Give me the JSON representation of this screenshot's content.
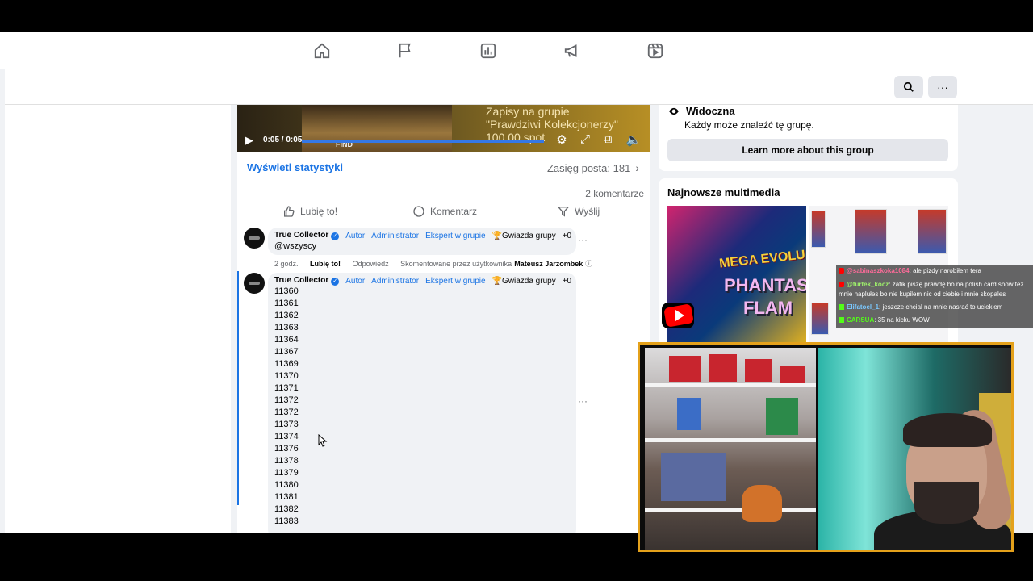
{
  "nav": {
    "icons": [
      "home-icon",
      "flag-icon",
      "stats-icon",
      "megaphone-icon",
      "reels-icon"
    ]
  },
  "subbar": {
    "search_icon": "search-icon",
    "more_label": "···"
  },
  "video": {
    "overlay_text_line1": "Zapisy na grupie",
    "overlay_text_line2": "\"Prawdziwi Kolekcjonerzy\"",
    "overlay_text_line3": "100,00 spot",
    "find_label": "FIND",
    "time": "0:05 / 0:05",
    "progress_fraction": 1.0
  },
  "post": {
    "stats_link": "Wyświetl statystyki",
    "reach": "Zasięg posta: 181",
    "comments_count": "2 komentarze",
    "actions": {
      "like": "Lubię to!",
      "comment": "Komentarz",
      "send": "Wyślij"
    }
  },
  "comments": [
    {
      "author": "True Collector",
      "badges": [
        "Autor",
        "Administrator",
        "Ekspert w grupie"
      ],
      "star_badge": "Gwiazda grupy",
      "plus": "+0",
      "text": "@wszyscy",
      "meta": {
        "time": "2 godz.",
        "like": "Lubię to!",
        "reply": "Odpowiedz",
        "commented_by": "Skomentowane przez użytkownika",
        "commenter": "Mateusz Jarzombek"
      }
    },
    {
      "author": "True Collector",
      "badges": [
        "Autor",
        "Administrator",
        "Ekspert w grupie"
      ],
      "star_badge": "Gwiazda grupy",
      "plus": "+0",
      "lines": [
        "11360",
        "11361",
        "11362",
        "11363",
        "11364",
        "11367",
        "11369",
        "11370",
        "11371",
        "11372",
        "11372",
        "11373",
        "11374",
        "11376",
        "11378",
        "11379",
        "11380",
        "11381",
        "11382",
        "11383"
      ]
    }
  ],
  "sidebar": {
    "visibility_title": "Widoczna",
    "visibility_desc": "Każdy może znaleźć tę grupę.",
    "learn_more": "Learn more about this group",
    "media_title": "Najnowsze multimedia",
    "media_text_1": "MEGA EVOLU",
    "media_text_2": "PHANTAS",
    "media_text_3": "FLAM"
  },
  "chat": [
    {
      "platform": "youtube",
      "user": "@sabinaszkoka1084",
      "msg": ": ale pizdy narobiłem tera"
    },
    {
      "platform": "youtube",
      "user": "@furtek_kocz",
      "msg": ": zafik piszę prawdę bo na polish card show też mnie naplułes bo nie kupilem nic od ciebie i mnie skopales"
    },
    {
      "platform": "kick",
      "user": "Elifatoel_1",
      "msg": ": jeszcze chciał na mnie nasrać to uciekłem"
    },
    {
      "platform": "kick",
      "user": "CARSUA",
      "msg": ": 35 na kicku WOW"
    }
  ],
  "colors": {
    "accent": "#1b74e4",
    "webcam_border": "#e4a11b",
    "youtube": "#ff0000",
    "kick": "#53fc18"
  }
}
